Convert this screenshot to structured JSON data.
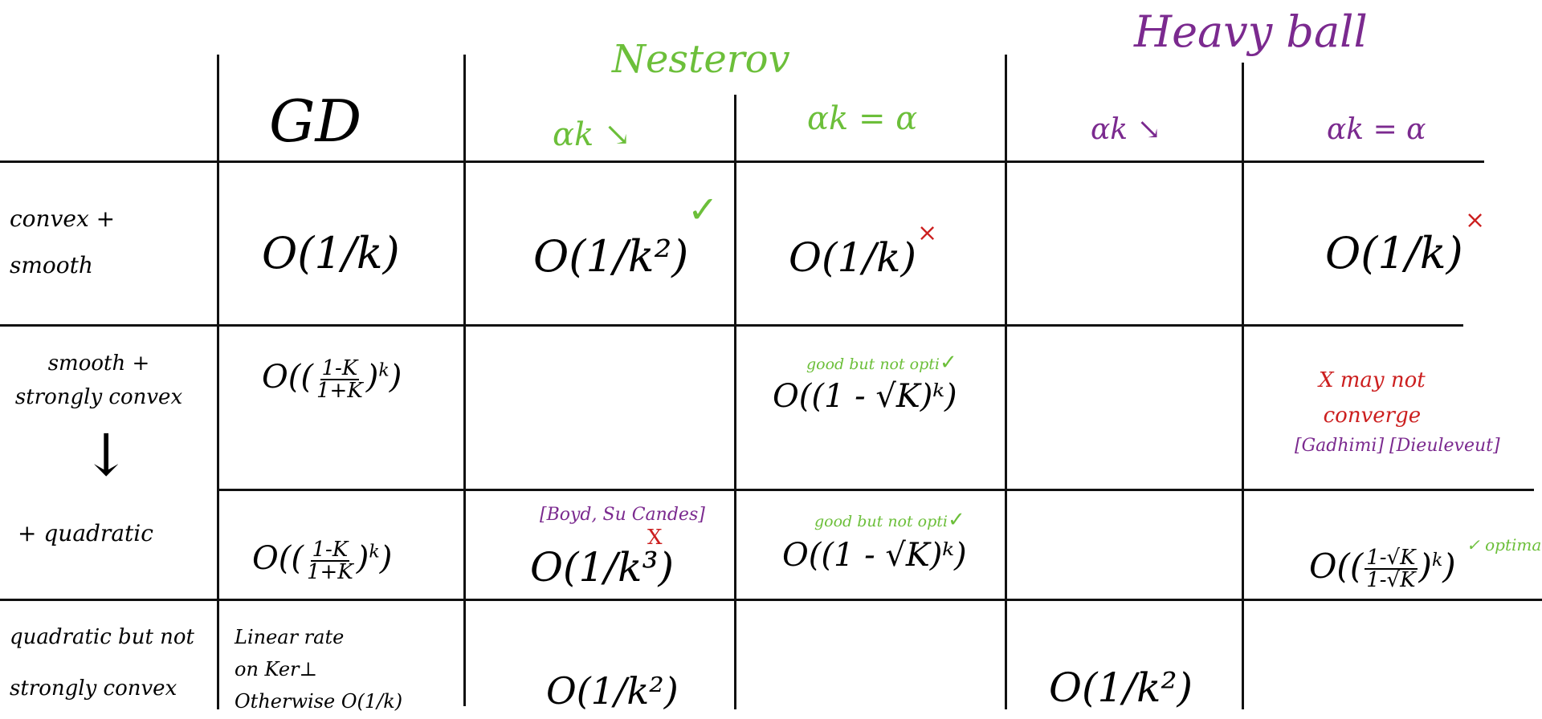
{
  "headers": {
    "gd": "GD",
    "nesterov": "Nesterov",
    "heavy_ball": "Heavy ball",
    "nesterov_decreasing": "αk ↘",
    "nesterov_constant": "αk = α",
    "hb_decreasing": "αk ↘",
    "hb_constant": "αk = α"
  },
  "rows": {
    "r1": "convex + smooth",
    "r2": "smooth + strongly convex",
    "r2_arrow": "↓",
    "r3": "+ quadratic",
    "r4_line1": "quadratic but not",
    "r4_line2": "strongly convex"
  },
  "cells": {
    "r1_gd": "O(1/k)",
    "r1_nest_dec": "O(1/k²)",
    "r1_nest_dec_mark": "✓",
    "r1_nest_const": "O(1/k)",
    "r1_nest_const_mark": "×",
    "r1_hb_const": "O(1/k)",
    "r1_hb_const_mark": "×",
    "r2_gd_prefix": "O((",
    "r2_gd_num": "1-K",
    "r2_gd_den": "1+K",
    "r2_gd_suffix": ")",
    "r2_gd_exp": "k",
    "r2_gd_close": ")",
    "r2_nest_const_note": "good but not opti",
    "r2_nest_const_note_mark": "✓",
    "r2_nest_const": "O((1 - √K)ᵏ)",
    "r2_hb_note_line1": "X may not",
    "r2_hb_note_line2": "converge",
    "r2_hb_refs": "[Gadhimi] [Dieuleveut]",
    "r3_gd_prefix": "O((",
    "r3_gd_num": "1-K",
    "r3_gd_den": "1+K",
    "r3_gd_suffix": ")",
    "r3_gd_exp": "k",
    "r3_gd_close": ")",
    "r3_nest_dec_ref": "[Boyd, Su Candes]",
    "r3_nest_dec": "O(1/k³)",
    "r3_nest_dec_mark": "X",
    "r3_nest_const_note": "good but not opti",
    "r3_nest_const_note_mark": "✓",
    "r3_nest_const": "O((1 - √K)ᵏ)",
    "r3_hb_const_prefix": "O((",
    "r3_hb_const_num": "1-√K",
    "r3_hb_const_den": "1-√K",
    "r3_hb_const_suffix": ")",
    "r3_hb_const_exp": "k",
    "r3_hb_const_close": ")",
    "r3_hb_const_mark": "✓ optimal",
    "r4_gd_line1": "Linear rate",
    "r4_gd_line2": "on Ker⊥",
    "r4_gd_line3": "Otherwise O(1/k)",
    "r4_nest_dec": "O(1/k²)",
    "r4_hb_dec": "O(1/k²)"
  },
  "colors": {
    "ink": "#000000",
    "nesterov": "#6cbf3a",
    "heavy_ball": "#7b2a8f",
    "cross": "#cc1f1f"
  }
}
